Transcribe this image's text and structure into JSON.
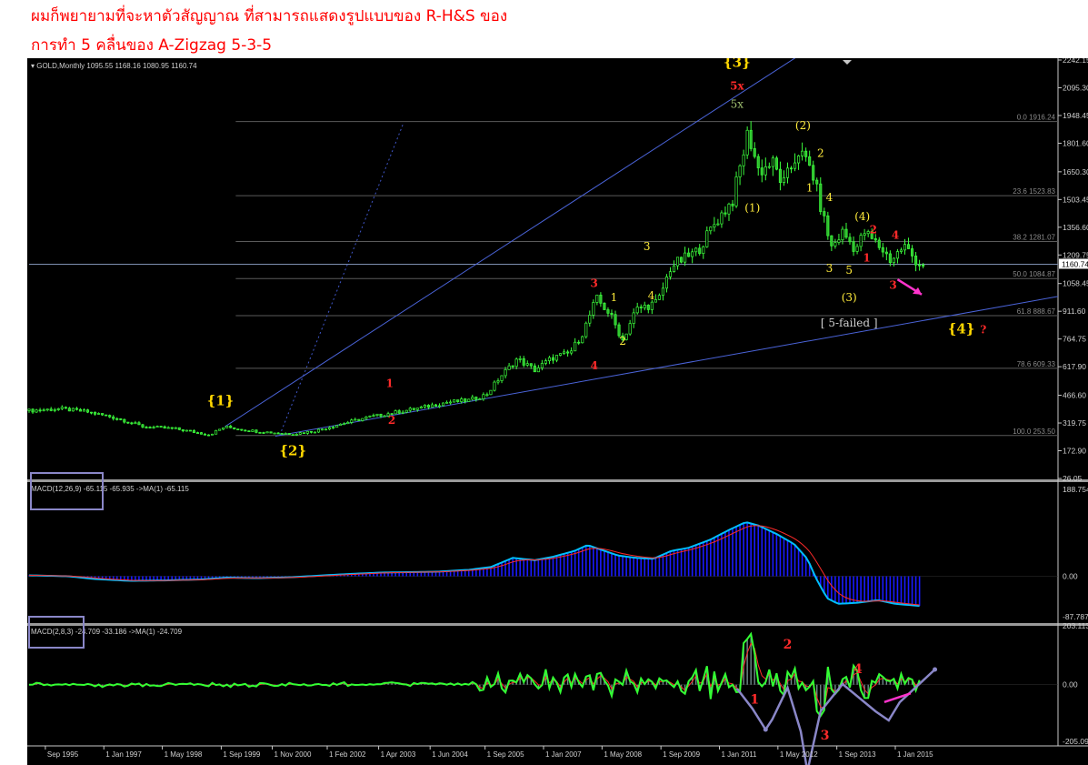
{
  "heading": {
    "line1": "ผมก็พยายามที่จะหาตัวสัญญาณ ที่สามารถแสดงรูปแบบของ R-H&S ของ",
    "line2": "การทำ 5 คลื่นของ A-Zigzag 5-3-5"
  },
  "chart_data": [
    {
      "type": "candlestick",
      "title": "GOLD,Monthly 1095.55 1168.16 1080.95 1160.74",
      "current_price_label": "1160.74",
      "price_axis_ticks": [
        "2242.15",
        "2095.30",
        "1948.45",
        "1801.60",
        "1650.30",
        "1503.45",
        "1356.60",
        "1209.75",
        "1058.45",
        "911.60",
        "764.75",
        "617.90",
        "466.60",
        "319.75",
        "172.90",
        "26.05"
      ],
      "price_axis_values": [
        2242.15,
        2095.3,
        1948.45,
        1801.6,
        1650.3,
        1503.45,
        1356.6,
        1209.75,
        1058.45,
        911.6,
        764.75,
        617.9,
        466.6,
        319.75,
        172.9,
        26.05
      ],
      "ylim": [
        26.05,
        2242.15
      ],
      "x_ticks": [
        "Sep 1995",
        "1 Jan 1997",
        "1 May 1998",
        "1 Sep 1999",
        "1 Nov 2000",
        "1 Feb 2002",
        "1 Apr 2003",
        "1 Jun 2004",
        "1 Sep 2005",
        "1 Jan 2007",
        "1 May 2008",
        "1 Sep 2009",
        "1 Jan 2011",
        "1 May 2012",
        "1 Sep 2013",
        "1 Jan 2015"
      ],
      "x_tick_years": [
        1995.67,
        1997.0,
        1998.33,
        1999.67,
        2000.83,
        2002.08,
        2003.25,
        2004.42,
        2005.67,
        2007.0,
        2008.33,
        2009.67,
        2011.0,
        2012.33,
        2013.67,
        2015.0
      ],
      "xlim": [
        1995.3,
        2018.7
      ],
      "series_approx": [
        [
          1995.3,
          385
        ],
        [
          1996.0,
          395
        ],
        [
          1996.6,
          380
        ],
        [
          1997.3,
          345
        ],
        [
          1997.9,
          300
        ],
        [
          1998.6,
          290
        ],
        [
          1999.4,
          258
        ],
        [
          1999.75,
          300
        ],
        [
          2000.3,
          280
        ],
        [
          2000.9,
          268
        ],
        [
          2001.3,
          262
        ],
        [
          2001.8,
          278
        ],
        [
          2002.4,
          315
        ],
        [
          2003.0,
          350
        ],
        [
          2003.6,
          375
        ],
        [
          2004.2,
          400
        ],
        [
          2004.8,
          430
        ],
        [
          2005.3,
          440
        ],
        [
          2005.7,
          470
        ],
        [
          2006.0,
          560
        ],
        [
          2006.4,
          660
        ],
        [
          2006.8,
          600
        ],
        [
          2007.2,
          665
        ],
        [
          2007.6,
          690
        ],
        [
          2007.9,
          800
        ],
        [
          2008.2,
          980
        ],
        [
          2008.5,
          900
        ],
        [
          2008.8,
          760
        ],
        [
          2009.1,
          920
        ],
        [
          2009.6,
          960
        ],
        [
          2009.9,
          1150
        ],
        [
          2010.5,
          1230
        ],
        [
          2010.9,
          1380
        ],
        [
          2011.3,
          1500
        ],
        [
          2011.65,
          1860
        ],
        [
          2011.9,
          1650
        ],
        [
          2012.2,
          1700
        ],
        [
          2012.45,
          1580
        ],
        [
          2012.8,
          1760
        ],
        [
          2013.1,
          1660
        ],
        [
          2013.35,
          1420
        ],
        [
          2013.55,
          1250
        ],
        [
          2013.8,
          1330
        ],
        [
          2014.1,
          1240
        ],
        [
          2014.3,
          1330
        ],
        [
          2014.7,
          1240
        ],
        [
          2014.9,
          1180
        ],
        [
          2015.2,
          1260
        ],
        [
          2015.5,
          1170
        ],
        [
          2015.6,
          1160
        ]
      ],
      "fibonacci_levels": [
        {
          "label": "0.0  1916.24",
          "value": 1916.24
        },
        {
          "label": "23.6  1523.83",
          "value": 1523.83
        },
        {
          "label": "38.2  1281.07",
          "value": 1281.07
        },
        {
          "label": "50.0  1084.87",
          "value": 1084.87
        },
        {
          "label": "61.8  888.67",
          "value": 888.67
        },
        {
          "label": "78.6  609.33",
          "value": 609.33
        },
        {
          "label": "100.0  253.50",
          "value": 253.5
        }
      ],
      "trendlines": [
        {
          "from": [
            1999.75,
            300
          ],
          "to": [
            2013.0,
            2295
          ]
        },
        {
          "from": [
            2000.9,
            250
          ],
          "to": [
            2018.7,
            990
          ]
        }
      ],
      "wave_labels": [
        {
          "text": "{1}",
          "x": 1999.65,
          "y": 415,
          "color": "#ffd700"
        },
        {
          "text": "{2}",
          "x": 2001.3,
          "y": 150,
          "color": "#ffd700"
        },
        {
          "text": "{3}",
          "x": 2011.4,
          "y": 2205,
          "color": "#ffd700"
        },
        {
          "text": "5x",
          "x": 2011.4,
          "y": 2085,
          "color": "#ff2a2a"
        },
        {
          "text": "5x",
          "x": 2011.4,
          "y": 1990,
          "color": "#a0c070"
        },
        {
          "text": "{4}",
          "x": 2016.5,
          "y": 795,
          "color": "#ffd700"
        },
        {
          "text": "?",
          "x": 2017.0,
          "y": 795,
          "color": "#ff2a2a"
        },
        {
          "text": "1",
          "x": 2003.5,
          "y": 510,
          "color": "#ff2a2a"
        },
        {
          "text": "2",
          "x": 2003.55,
          "y": 315,
          "color": "#ff2a2a"
        },
        {
          "text": "3",
          "x": 2008.15,
          "y": 1040,
          "color": "#ff2a2a"
        },
        {
          "text": "4",
          "x": 2008.15,
          "y": 605,
          "color": "#ff2a2a"
        },
        {
          "text": "1",
          "x": 2008.6,
          "y": 965,
          "color": "#ffeb3b"
        },
        {
          "text": "2",
          "x": 2008.8,
          "y": 735,
          "color": "#ffeb3b"
        },
        {
          "text": "3",
          "x": 2009.35,
          "y": 1235,
          "color": "#ffeb3b"
        },
        {
          "text": "4",
          "x": 2009.45,
          "y": 975,
          "color": "#ffeb3b"
        },
        {
          "text": "(1)",
          "x": 2011.75,
          "y": 1440,
          "color": "#ffeb3b"
        },
        {
          "text": "(2)",
          "x": 2012.9,
          "y": 1875,
          "color": "#ffeb3b"
        },
        {
          "text": "2",
          "x": 2013.3,
          "y": 1730,
          "color": "#ffeb3b"
        },
        {
          "text": "1",
          "x": 2013.05,
          "y": 1545,
          "color": "#ffeb3b"
        },
        {
          "text": "4",
          "x": 2013.5,
          "y": 1495,
          "color": "#ffeb3b"
        },
        {
          "text": "(4)",
          "x": 2014.25,
          "y": 1395,
          "color": "#ffeb3b"
        },
        {
          "text": "2",
          "x": 2014.5,
          "y": 1325,
          "color": "#ff2a2a"
        },
        {
          "text": "4",
          "x": 2015.0,
          "y": 1295,
          "color": "#ff2a2a"
        },
        {
          "text": "3",
          "x": 2013.5,
          "y": 1120,
          "color": "#ffeb3b"
        },
        {
          "text": "5",
          "x": 2013.95,
          "y": 1110,
          "color": "#ffeb3b"
        },
        {
          "text": "1",
          "x": 2014.35,
          "y": 1175,
          "color": "#ff2a2a"
        },
        {
          "text": "3",
          "x": 2014.95,
          "y": 1030,
          "color": "#ff2a2a"
        },
        {
          "text": "(3)",
          "x": 2013.95,
          "y": 965,
          "color": "#ffeb3b"
        },
        {
          "text": "[ 5-failed ]",
          "x": 2013.95,
          "y": 830,
          "color": "#d0d0d0"
        }
      ],
      "arrow_color": "#ff33cc"
    },
    {
      "type": "bar+line",
      "title": "MACD(12,26,9) -65.115 -65.935  ->MA(1) -65.115",
      "axis_ticks": [
        "188.754",
        "0.00",
        "-87.787"
      ],
      "axis_values": [
        188.754,
        0.0,
        -87.787
      ],
      "ylim": [
        -100,
        205
      ],
      "series_approx": [
        [
          1995.3,
          2
        ],
        [
          1996.2,
          0
        ],
        [
          1996.8,
          -6
        ],
        [
          1997.6,
          -10
        ],
        [
          1998.4,
          -9
        ],
        [
          1999.2,
          -7
        ],
        [
          1999.8,
          -3
        ],
        [
          2000.5,
          -4
        ],
        [
          2001.3,
          -2
        ],
        [
          2002.0,
          2
        ],
        [
          2002.6,
          5
        ],
        [
          2003.3,
          8
        ],
        [
          2004.0,
          9
        ],
        [
          2004.6,
          10
        ],
        [
          2005.3,
          14
        ],
        [
          2005.8,
          20
        ],
        [
          2006.3,
          40
        ],
        [
          2006.8,
          35
        ],
        [
          2007.2,
          42
        ],
        [
          2007.7,
          55
        ],
        [
          2008.0,
          68
        ],
        [
          2008.3,
          58
        ],
        [
          2008.7,
          45
        ],
        [
          2009.1,
          40
        ],
        [
          2009.5,
          38
        ],
        [
          2009.9,
          55
        ],
        [
          2010.3,
          62
        ],
        [
          2010.8,
          80
        ],
        [
          2011.2,
          100
        ],
        [
          2011.6,
          118
        ],
        [
          2011.9,
          110
        ],
        [
          2012.3,
          92
        ],
        [
          2012.7,
          70
        ],
        [
          2013.0,
          38
        ],
        [
          2013.2,
          -5
        ],
        [
          2013.45,
          -48
        ],
        [
          2013.7,
          -60
        ],
        [
          2014.1,
          -58
        ],
        [
          2014.6,
          -52
        ],
        [
          2015.0,
          -60
        ],
        [
          2015.6,
          -65
        ]
      ],
      "bar_color": "#1a1aff",
      "line_color": "#00bfff",
      "signal_color": "#ff2a2a"
    },
    {
      "type": "bar+line",
      "title": "MACD(2,8,3) -24.709 -33.186  ->MA(1) -24.709",
      "axis_ticks": [
        "203.113",
        "0.00",
        "-205.093"
      ],
      "axis_values": [
        203.113,
        0.0,
        -205.093
      ],
      "ylim": [
        -205.093,
        203.113
      ],
      "wave_labels": [
        {
          "text": "1",
          "x": 2011.8,
          "y": -65,
          "color": "#ff2a2a"
        },
        {
          "text": "2",
          "x": 2012.55,
          "y": 125,
          "color": "#ff2a2a"
        },
        {
          "text": "3",
          "x": 2013.4,
          "y": -190,
          "color": "#ff2a2a"
        },
        {
          "text": "4",
          "x": 2014.15,
          "y": 40,
          "color": "#ff2a2a"
        }
      ],
      "bar_color": "#6f8a8a",
      "line_color": "#33ff33",
      "signal_color": "#ff2a2a"
    }
  ]
}
